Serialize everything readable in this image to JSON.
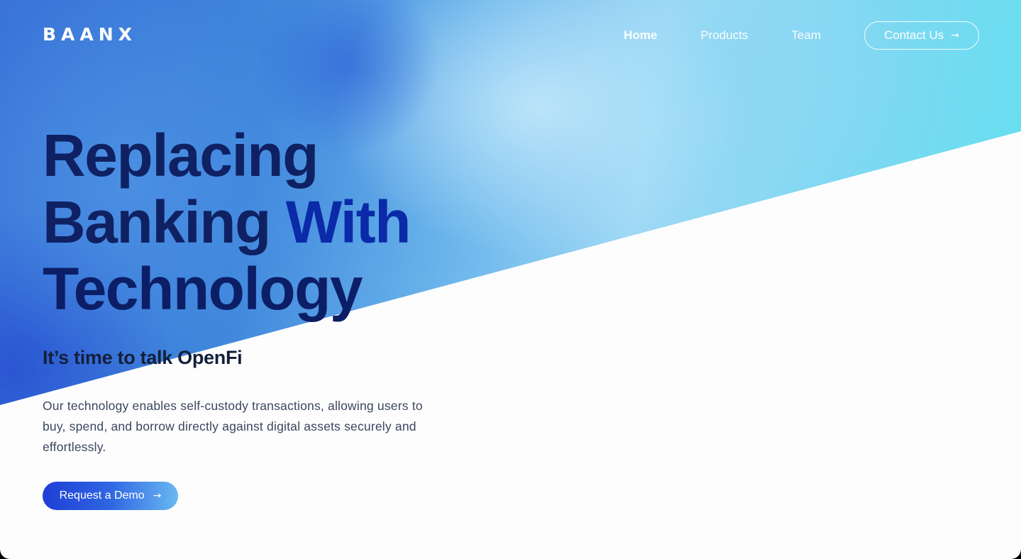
{
  "header": {
    "logo": "BAANX",
    "nav": [
      {
        "label": "Home",
        "active": true
      },
      {
        "label": "Products",
        "active": false
      },
      {
        "label": "Team",
        "active": false
      }
    ],
    "contact_label": "Contact Us",
    "arrow_icon": "arrow-right-icon"
  },
  "hero": {
    "headline": {
      "line1": "Replacing",
      "line2a": "Banking",
      "line2b": "With",
      "line3": "Technology"
    },
    "subhead": "It’s time to talk OpenFi",
    "description": "Our technology enables self-custody transactions, allowing users to buy, spend, and borrow directly against digital assets securely and effortlessly.",
    "cta_label": "Request a Demo"
  },
  "colors": {
    "headline_dark": "#0f2162",
    "headline_accent": "#0a2aa8",
    "cta_start": "#1f3ed6",
    "cta_end": "#6ab8f2"
  }
}
